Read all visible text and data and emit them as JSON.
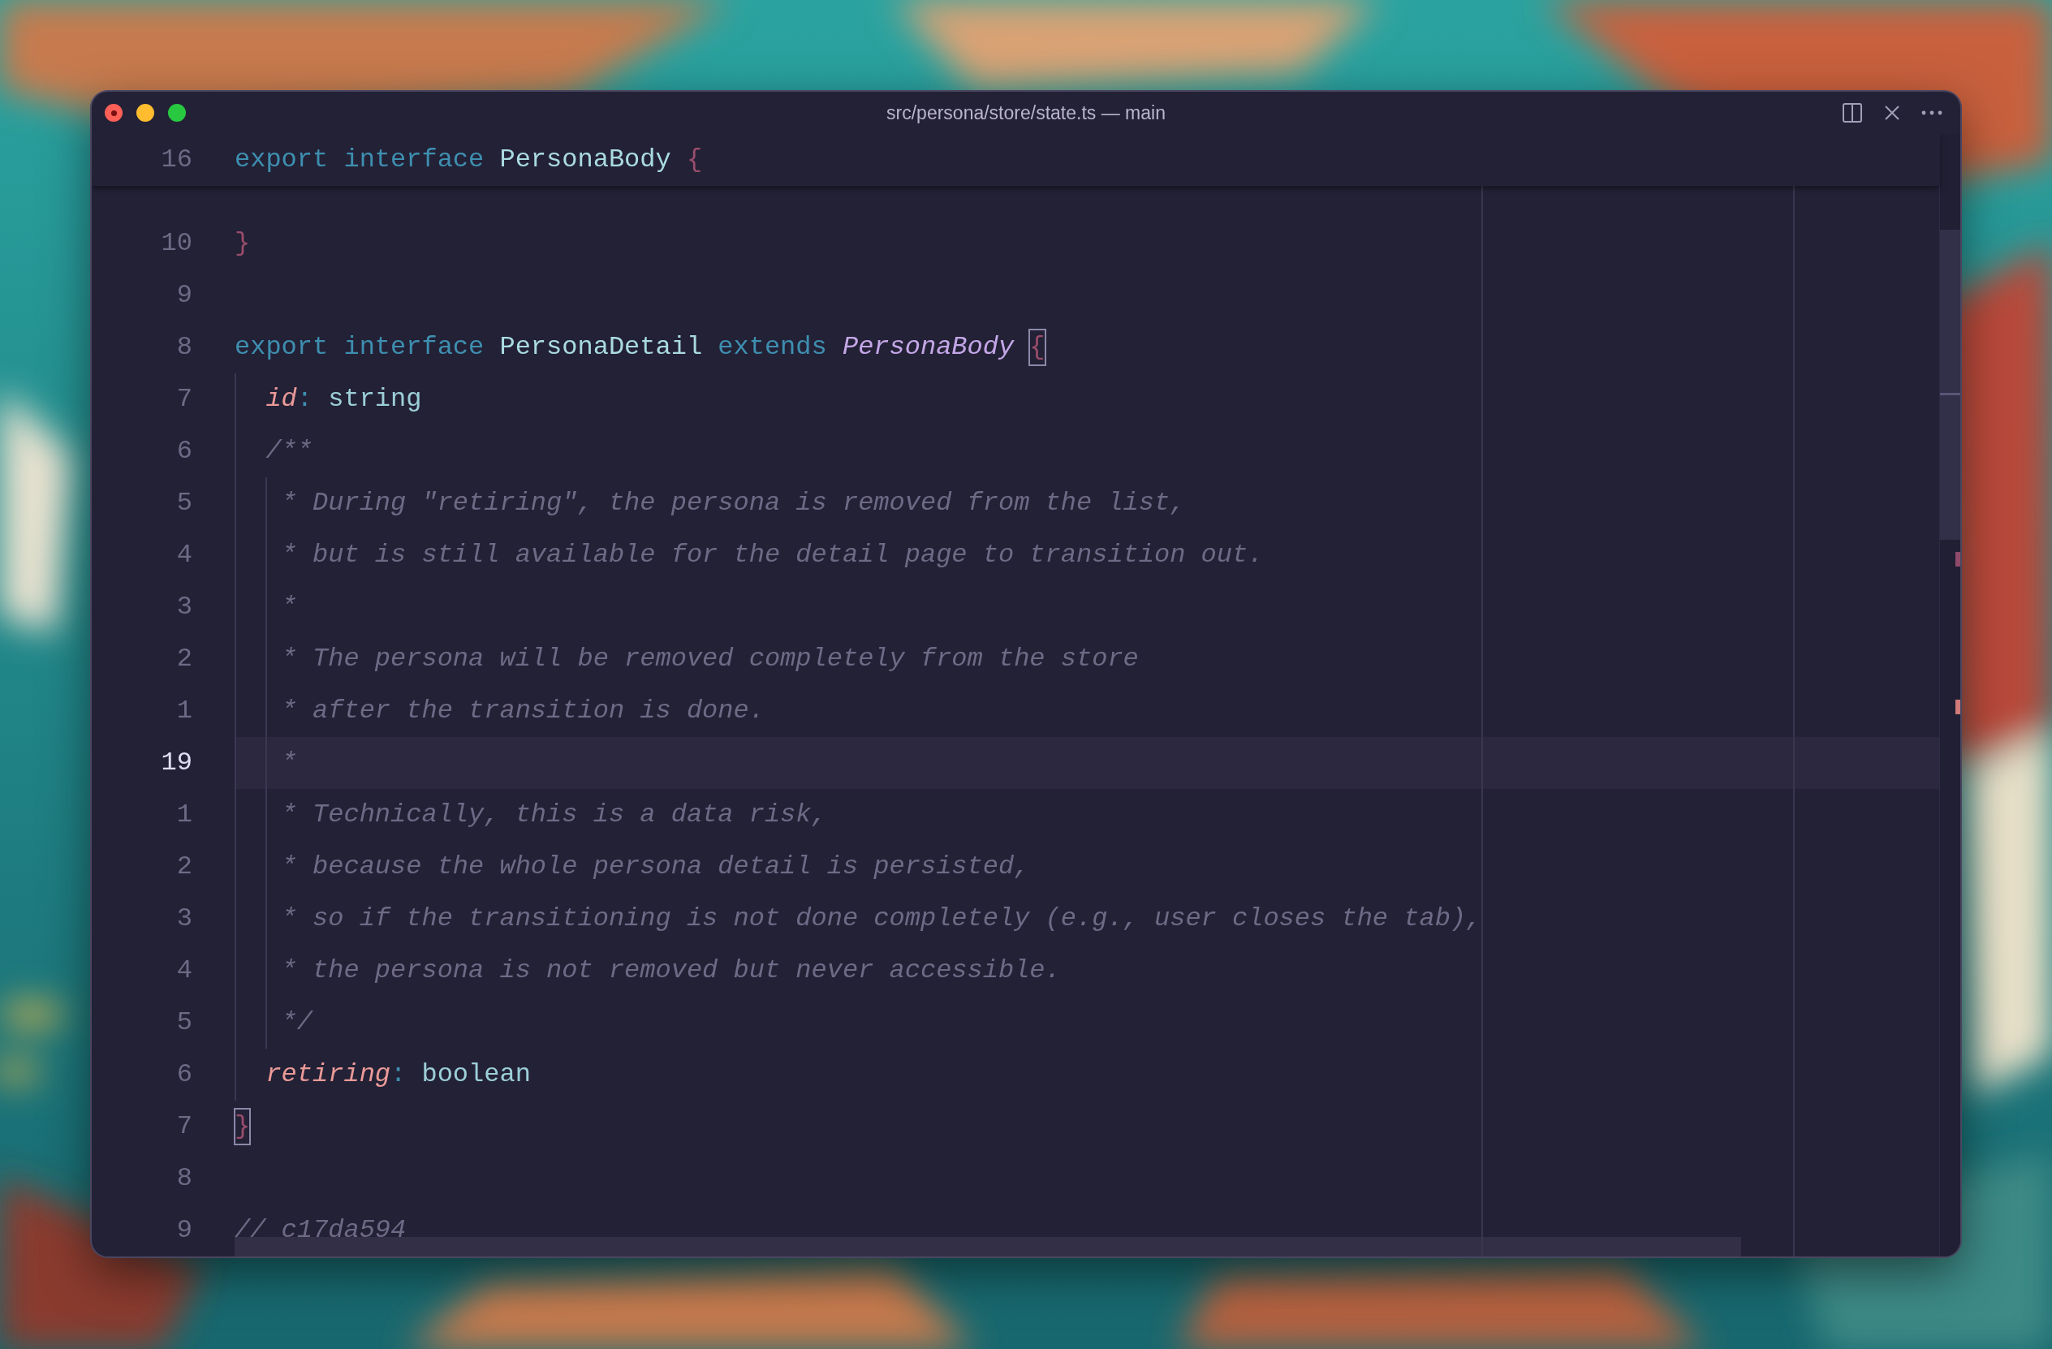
{
  "window": {
    "title": "src/persona/store/state.ts — main"
  },
  "sticky_header": {
    "number": "16",
    "tokens": [
      {
        "kind": "keyword",
        "text": "export interface "
      },
      {
        "kind": "type",
        "text": "PersonaBody "
      },
      {
        "kind": "brace",
        "text": "{",
        "matched": false
      }
    ]
  },
  "lines": [
    {
      "number": "10",
      "current": false,
      "tokens": [
        {
          "kind": "brace",
          "text": "}",
          "matched": false
        }
      ]
    },
    {
      "number": "9",
      "current": false
    },
    {
      "number": "8",
      "current": false,
      "tokens": [
        {
          "kind": "keyword",
          "text": "export interface "
        },
        {
          "kind": "type",
          "text": "PersonaDetail "
        },
        {
          "kind": "keyword",
          "text": "extends "
        },
        {
          "kind": "inherited",
          "text": "PersonaBody "
        },
        {
          "kind": "brace",
          "text": "{",
          "matched": true
        }
      ]
    },
    {
      "number": "7",
      "current": false,
      "tokens": [
        {
          "kind": "property",
          "text": "  id"
        },
        {
          "kind": "punct",
          "text": ": "
        },
        {
          "kind": "builtin",
          "text": "string"
        }
      ]
    },
    {
      "number": "6",
      "current": false,
      "tokens": [
        {
          "kind": "comment",
          "text": "  /**"
        }
      ]
    },
    {
      "number": "5",
      "current": false,
      "tokens": [
        {
          "kind": "comment",
          "text": "   * During \"retiring\", the persona is removed from the list,"
        }
      ]
    },
    {
      "number": "4",
      "current": false,
      "tokens": [
        {
          "kind": "comment",
          "text": "   * but is still available for the detail page to transition out."
        }
      ]
    },
    {
      "number": "3",
      "current": false,
      "tokens": [
        {
          "kind": "comment",
          "text": "   *"
        }
      ]
    },
    {
      "number": "2",
      "current": false,
      "tokens": [
        {
          "kind": "comment",
          "text": "   * The persona will be removed completely from the store"
        }
      ]
    },
    {
      "number": "1",
      "current": false,
      "tokens": [
        {
          "kind": "comment",
          "text": "   * after the transition is done."
        }
      ]
    },
    {
      "number": "19",
      "current": true,
      "tokens": [
        {
          "kind": "comment",
          "text": "   *"
        }
      ]
    },
    {
      "number": "1",
      "current": false,
      "tokens": [
        {
          "kind": "comment",
          "text": "   * Technically, this is a data risk,"
        }
      ]
    },
    {
      "number": "2",
      "current": false,
      "tokens": [
        {
          "kind": "comment",
          "text": "   * because the whole persona detail is persisted,"
        }
      ]
    },
    {
      "number": "3",
      "current": false,
      "tokens": [
        {
          "kind": "comment",
          "text": "   * so if the transitioning is not done completely (e.g., user closes the tab),"
        }
      ]
    },
    {
      "number": "4",
      "current": false,
      "tokens": [
        {
          "kind": "comment",
          "text": "   * the persona is not removed but never accessible."
        }
      ]
    },
    {
      "number": "5",
      "current": false,
      "tokens": [
        {
          "kind": "comment",
          "text": "   */"
        }
      ]
    },
    {
      "number": "6",
      "current": false,
      "tokens": [
        {
          "kind": "property",
          "text": "  retiring"
        },
        {
          "kind": "punct",
          "text": ": "
        },
        {
          "kind": "builtin",
          "text": "boolean"
        }
      ]
    },
    {
      "number": "7",
      "current": false,
      "tokens": [
        {
          "kind": "brace",
          "text": "}",
          "matched": true
        }
      ]
    },
    {
      "number": "8",
      "current": false
    },
    {
      "number": "9",
      "current": false,
      "tokens": [
        {
          "kind": "comment",
          "text": "// c17da594"
        }
      ]
    }
  ]
}
